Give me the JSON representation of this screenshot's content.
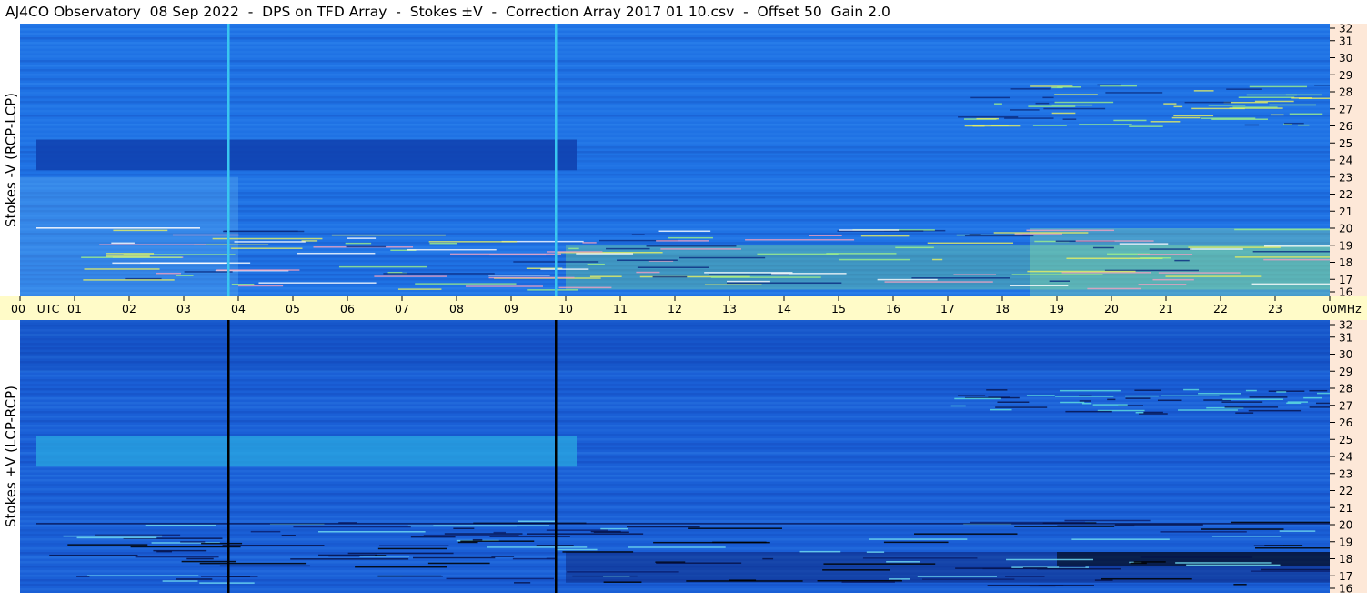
{
  "title": "AJ4CO Observatory  08 Sep 2022  -  DPS on TFD Array  -  Stokes ±V  -  Correction Array 2017 01 10.csv  -  Offset 50  Gain 2.0",
  "colors": {
    "top_base": "#1f72e4",
    "top_dark_band": "#0f3fae",
    "top_hot": "#7ee08a",
    "bottom_base": "#1a5fd6",
    "bottom_dark": "#0a1f70",
    "bottom_light_band": "#29a8e0",
    "freq_axis_bg": "#fde8d8",
    "time_axis_bg": "#fffbc8"
  },
  "chart_data": [
    {
      "type": "heatmap",
      "panel": "top",
      "ylabel": "Stokes -V (RCP-LCP)",
      "x_unit": "UTC",
      "x_range": [
        0,
        24
      ],
      "y_unit": "MHz",
      "y_range": [
        16,
        32
      ],
      "y_ticks": [
        "32",
        "31",
        "30",
        "29",
        "28",
        "27",
        "26",
        "25",
        "24",
        "23",
        "22",
        "21",
        "20",
        "19",
        "18",
        "17",
        "16"
      ],
      "vertical_lines_utc": [
        3.8,
        9.8
      ],
      "vertical_line_color": "#39c6f0",
      "dark_band_mhz": [
        23.4,
        25.2
      ],
      "bright_band_mhz": [
        16.4,
        19.0
      ],
      "bright_activity_start_utc": 10.0
    },
    {
      "type": "heatmap",
      "panel": "bottom",
      "ylabel": "Stokes +V (LCP-RCP)",
      "x_unit": "UTC",
      "x_range": [
        0,
        24
      ],
      "y_unit": "MHz",
      "y_range": [
        16,
        32
      ],
      "y_ticks": [
        "32",
        "31",
        "30",
        "29",
        "28",
        "27",
        "26",
        "25",
        "24",
        "23",
        "22",
        "21",
        "20",
        "19",
        "18",
        "17",
        "16"
      ],
      "vertical_lines_utc": [
        3.8,
        9.8
      ],
      "vertical_line_color": "#000000",
      "light_band_mhz": [
        23.4,
        25.2
      ],
      "dark_band_mhz": [
        16.6,
        18.4
      ],
      "dark_activity_start_utc": 10.0
    }
  ],
  "time_axis": {
    "unit_label": "UTC",
    "end_unit": "MHz",
    "labels": [
      "00",
      "01",
      "02",
      "03",
      "04",
      "05",
      "06",
      "07",
      "08",
      "09",
      "10",
      "11",
      "12",
      "13",
      "14",
      "15",
      "16",
      "17",
      "18",
      "19",
      "20",
      "21",
      "22",
      "23",
      "00"
    ]
  }
}
